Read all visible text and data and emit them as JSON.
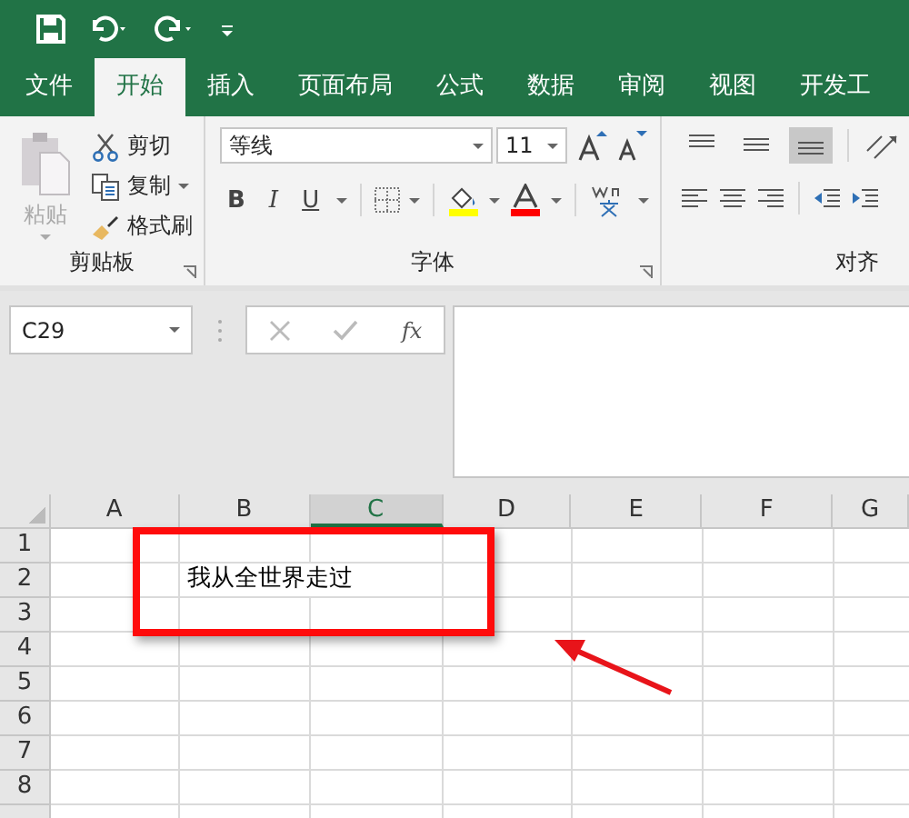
{
  "tabs": [
    {
      "label": "文件",
      "selected": false
    },
    {
      "label": "开始",
      "selected": true
    },
    {
      "label": "插入",
      "selected": false
    },
    {
      "label": "页面布局",
      "selected": false
    },
    {
      "label": "公式",
      "selected": false
    },
    {
      "label": "数据",
      "selected": false
    },
    {
      "label": "审阅",
      "selected": false
    },
    {
      "label": "视图",
      "selected": false
    },
    {
      "label": "开发工",
      "selected": false
    }
  ],
  "ribbon": {
    "clipboard": {
      "label": "剪贴板",
      "paste": {
        "label": "粘贴",
        "disabled": true
      },
      "items": [
        {
          "kind": "cut",
          "label": "剪切",
          "dropdown": false
        },
        {
          "kind": "copy",
          "label": "复制",
          "dropdown": true
        },
        {
          "kind": "painter",
          "label": "格式刷",
          "dropdown": false
        }
      ]
    },
    "font": {
      "label": "字体",
      "font_name": "等线",
      "font_size": "11",
      "style_buttons": [
        {
          "kind": "bold",
          "label": "B"
        },
        {
          "kind": "italic",
          "label": "I"
        },
        {
          "kind": "underline",
          "label": "U"
        }
      ]
    },
    "alignment": {
      "label": "对齐",
      "vertical_align": [
        {
          "selected": false
        },
        {
          "selected": false
        },
        {
          "selected": true
        }
      ]
    }
  },
  "formula_bar": {
    "name_box": "C29",
    "function_label": "fx"
  },
  "sheet": {
    "columns": [
      {
        "label": "A",
        "selected": false
      },
      {
        "label": "B",
        "selected": false
      },
      {
        "label": "C",
        "selected": true
      },
      {
        "label": "D",
        "selected": false
      },
      {
        "label": "E",
        "selected": false
      },
      {
        "label": "F",
        "selected": false
      },
      {
        "label": "G",
        "selected": false
      }
    ],
    "rows": [
      "1",
      "2",
      "3",
      "4",
      "5",
      "6",
      "7",
      "8"
    ],
    "cell_text": "我从全世界走过"
  }
}
